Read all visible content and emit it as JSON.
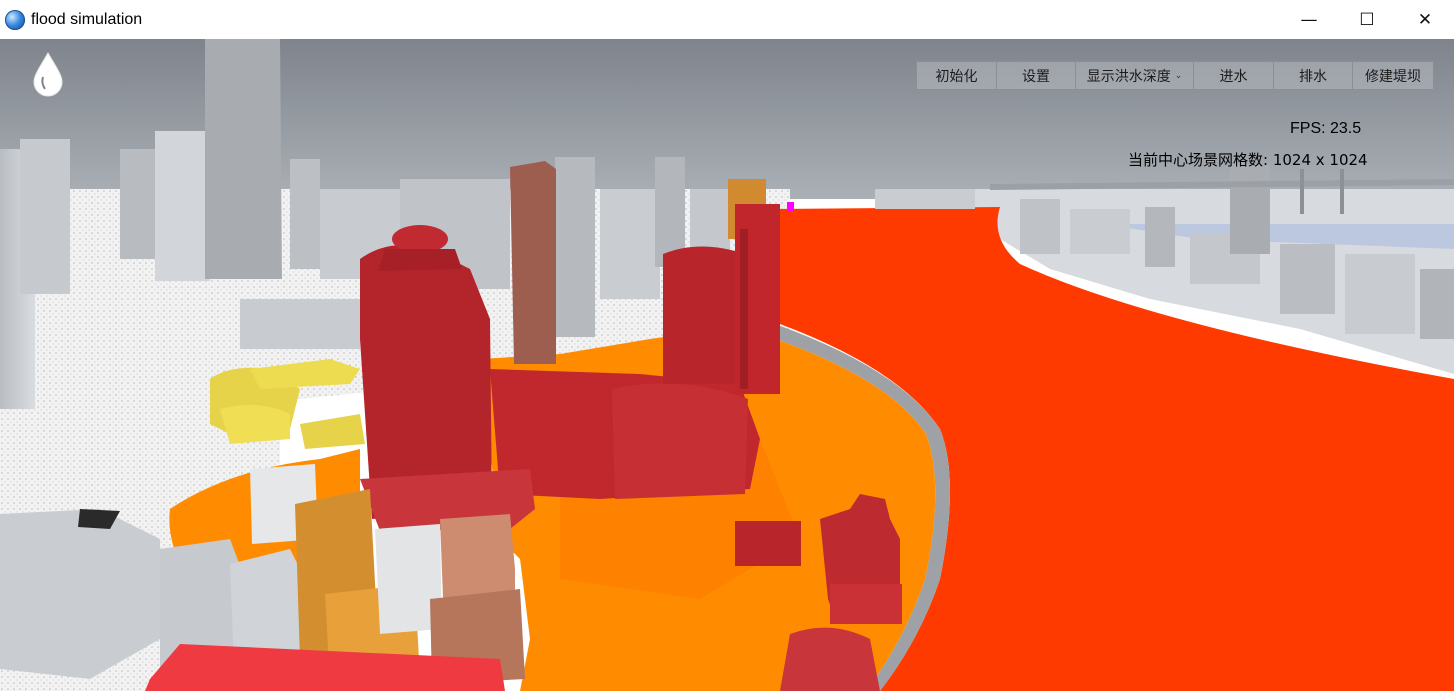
{
  "window": {
    "title": "flood simulation",
    "minimize_glyph": "—",
    "maximize_glyph": "☐",
    "close_glyph": "✕"
  },
  "toolbar": {
    "init_label": "初始化",
    "settings_label": "设置",
    "display_label": "显示洪水深度",
    "inflow_label": "进水",
    "drain_label": "排水",
    "levee_label": "修建堤坝"
  },
  "hud": {
    "fps_text": "FPS: 23.5",
    "grid_label": "当前中心场景网格数:",
    "grid_value": "1024 x 1024"
  },
  "colors": {
    "river": "#ff3a00",
    "flood_shallow": "#ff8a00",
    "building_submerged": "#b0242b",
    "building_partial": "#d08a2c",
    "building_dry": "#c8ccd0",
    "sky": "#8f949c"
  },
  "icons": {
    "app": "globe-icon",
    "logo": "water-drop-icon",
    "dropdown": "chevron-down-icon"
  }
}
